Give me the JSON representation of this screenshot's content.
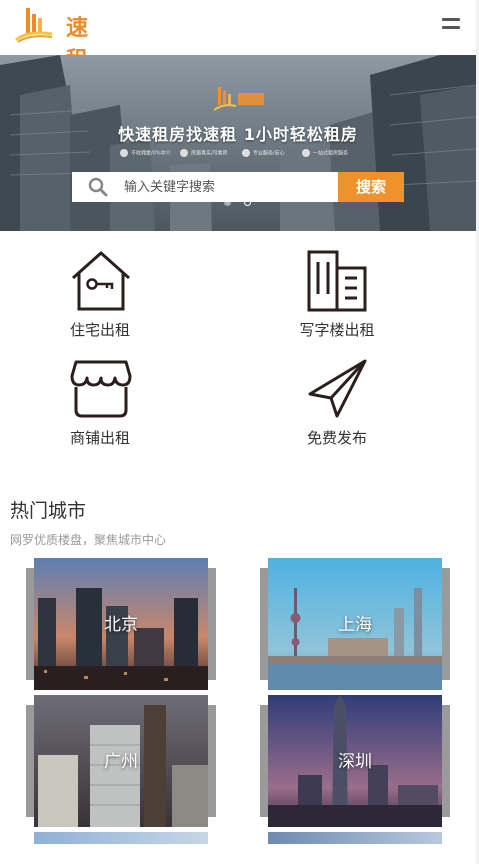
{
  "header": {
    "brand": "速租",
    "menu_icon": "menu-icon"
  },
  "banner": {
    "slogan": "快速租房找速租  1小时轻松租房",
    "features": [
      "不收佣金/0%中介",
      "房源真实/可看房",
      "专业服务/安心",
      "一站式租房服务"
    ],
    "search_placeholder": "输入关键字搜索",
    "search_button": "搜索",
    "slides": 2,
    "active_slide": 1
  },
  "categories": [
    {
      "label": "住宅出租",
      "icon": "house-key-icon"
    },
    {
      "label": "写字楼出租",
      "icon": "office-building-icon"
    },
    {
      "label": "商铺出租",
      "icon": "storefront-icon"
    },
    {
      "label": "免费发布",
      "icon": "paper-plane-icon"
    }
  ],
  "hot_cities": {
    "title": "热门城市",
    "subtitle": "网罗优质楼盘，聚焦城市中心",
    "cities": [
      "北京",
      "上海",
      "广州",
      "深圳"
    ]
  },
  "colors": {
    "accent": "#f0922b",
    "text": "#333333",
    "muted": "#999999"
  }
}
